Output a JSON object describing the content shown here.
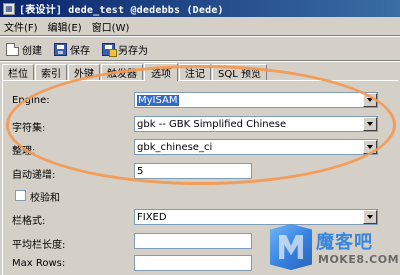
{
  "window": {
    "title": "[表设计] dede_test @dedebbs (Dede)"
  },
  "menu": [
    "文件(F)",
    "编辑(E)",
    "窗口(W)"
  ],
  "toolbar": {
    "create_label": "创建",
    "save_label": "保存",
    "save_as_label": "另存为"
  },
  "tabs": [
    "栏位",
    "索引",
    "外键",
    "触发器",
    "选项",
    "注记",
    "SQL 预览"
  ],
  "active_tab_index": 4,
  "options": {
    "engine": {
      "label": "Engine:",
      "value": "MyISAM"
    },
    "charset": {
      "label": "字符集:",
      "value": "gbk -- GBK Simplified Chinese"
    },
    "collation": {
      "label": "整理:",
      "value": "gbk_chinese_ci"
    },
    "auto_increment": {
      "label": "自动递增:",
      "value": "5"
    },
    "checksum": {
      "label": "校验和",
      "checked": false
    },
    "row_format": {
      "label": "栏格式:",
      "value": "FIXED"
    },
    "avg_row_length": {
      "label": "平均栏长度:",
      "value": ""
    },
    "max_rows": {
      "label": "Max Rows:",
      "value": ""
    }
  },
  "watermark": {
    "name": "魔客吧",
    "site": "MOKE8.COM"
  },
  "colors": {
    "titlebar_start": "#0a246a",
    "highlight_oval": "#f29a55",
    "selection": "#316ac5",
    "watermark_blue": "#2a7fe0"
  }
}
